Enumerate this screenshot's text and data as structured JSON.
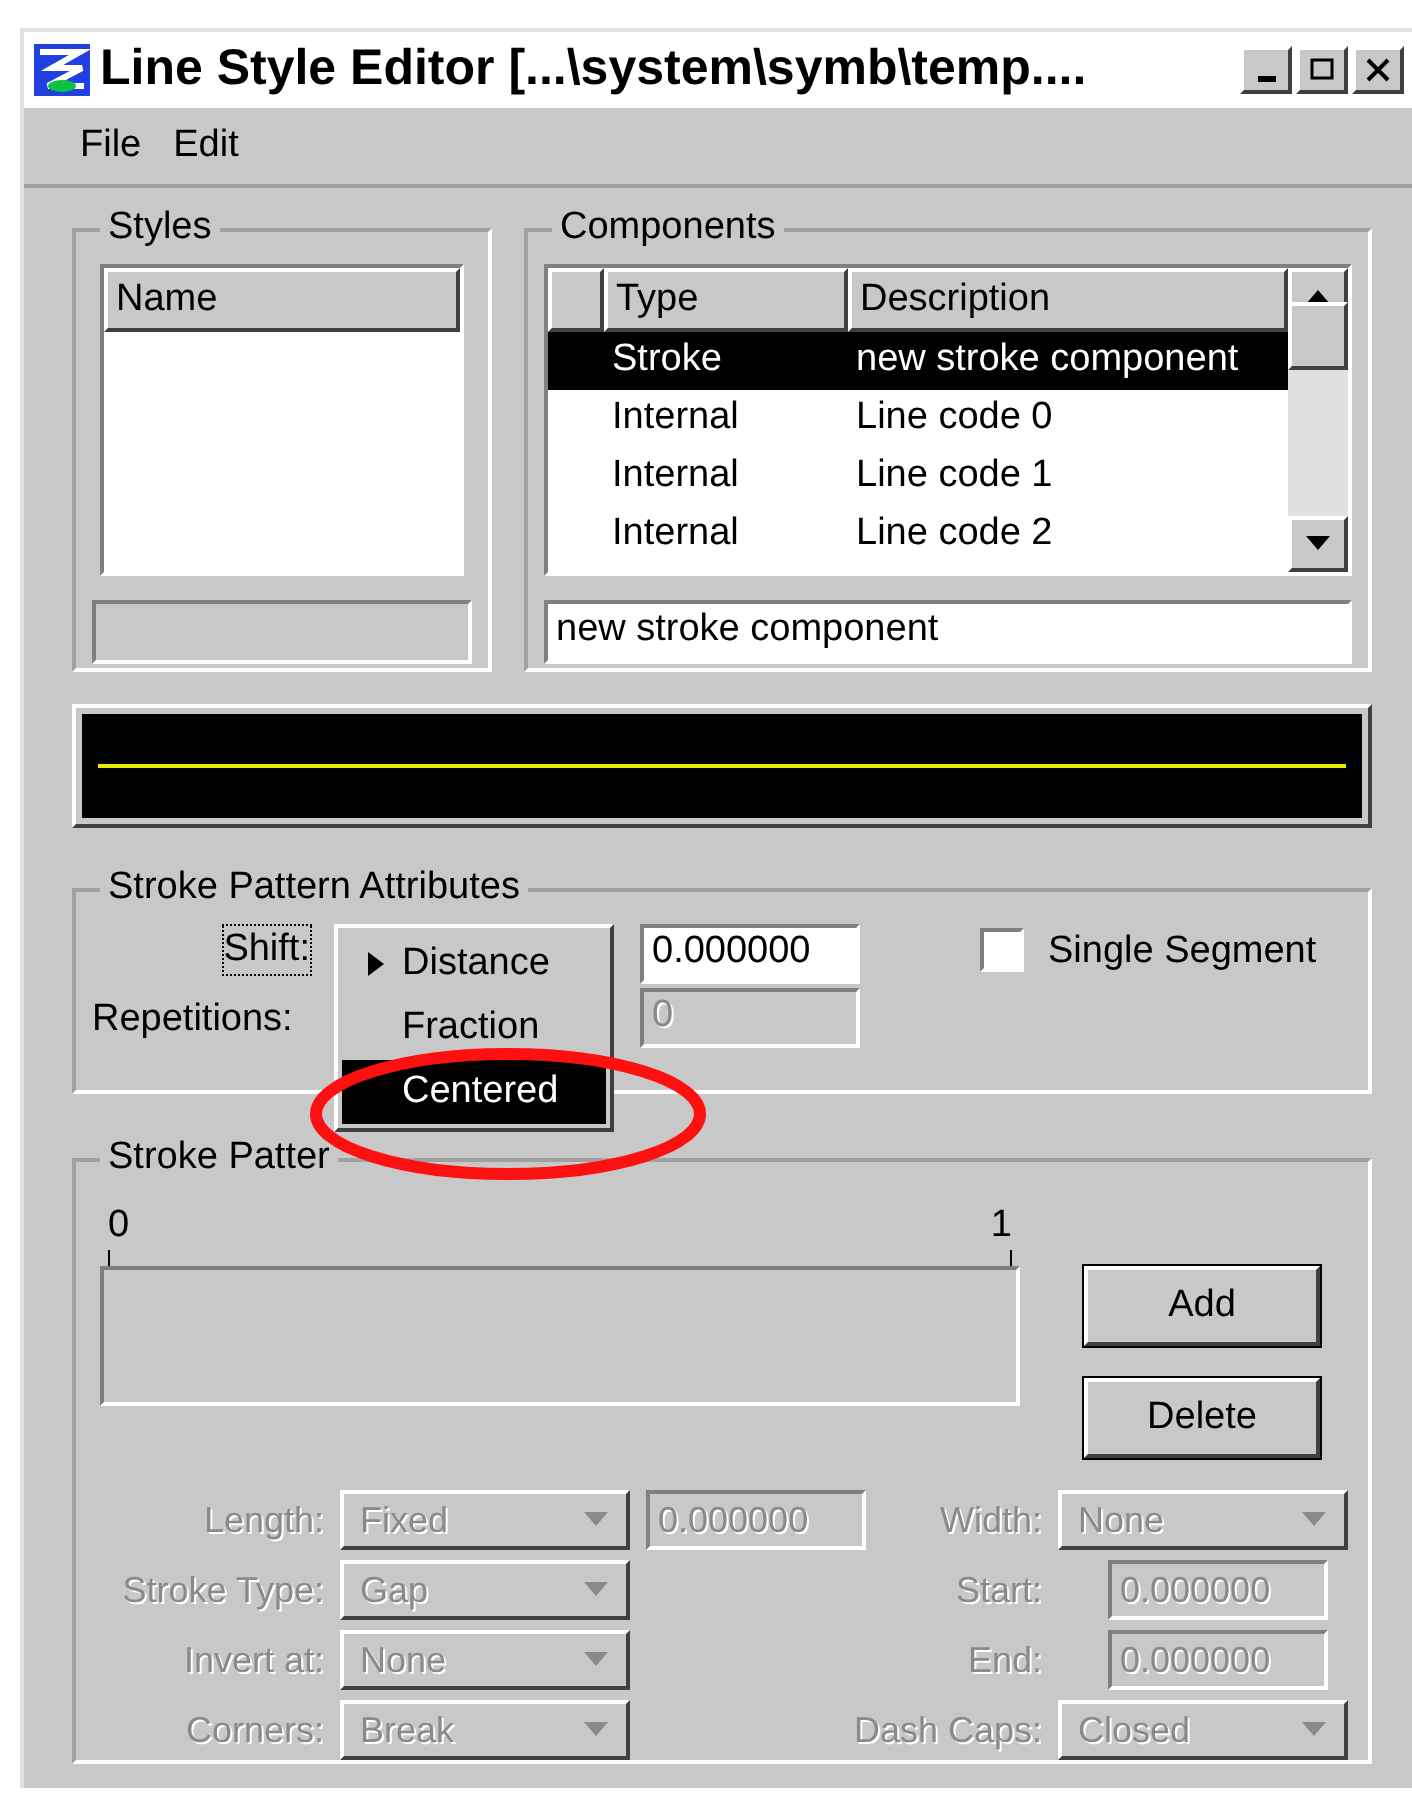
{
  "window": {
    "title": "Line Style Editor [...\\system\\symb\\temp...."
  },
  "menu": [
    {
      "label": "File"
    },
    {
      "label": "Edit"
    }
  ],
  "styles": {
    "title": "Styles",
    "columns": [
      "Name"
    ],
    "name_field": {
      "disabled": true
    }
  },
  "components": {
    "title": "Components",
    "columns": [
      "Type",
      "Description"
    ],
    "rows": [
      {
        "type": "Stroke",
        "description": "new stroke component",
        "selected": true
      },
      {
        "type": "Internal",
        "description": "Line code 0",
        "selected": false
      },
      {
        "type": "Internal",
        "description": "Line code 1",
        "selected": false
      },
      {
        "type": "Internal",
        "description": "Line code 2",
        "selected": false
      }
    ],
    "description_field": {
      "value": "new stroke component"
    }
  },
  "attributes": {
    "title": "Stroke Pattern Attributes",
    "shift": {
      "label": "Shift:",
      "value": "0.000000"
    },
    "repetitions": {
      "label": "Repetitions:",
      "value": "0",
      "disabled": true
    },
    "shift_menu": [
      {
        "label": "Distance",
        "checked": true,
        "selected": false
      },
      {
        "label": "Fraction",
        "checked": false,
        "selected": false
      },
      {
        "label": "Centered",
        "checked": false,
        "selected": true
      }
    ],
    "single_segment": {
      "label": "Single Segment",
      "checked": false
    }
  },
  "pattern": {
    "title": "Stroke Patter",
    "scale_start": "0",
    "scale_end": "1",
    "buttons": [
      {
        "label": "Add"
      },
      {
        "label": "Delete"
      }
    ],
    "fields": [
      {
        "kind": "select",
        "label": "Length:",
        "value": "Fixed",
        "disabled": true
      },
      {
        "kind": "input",
        "value": "0.000000",
        "disabled": true
      },
      {
        "kind": "select",
        "label": "Width:",
        "value": "None",
        "disabled": true
      },
      {
        "kind": "select",
        "label": "Stroke Type:",
        "value": "Gap",
        "disabled": true
      },
      {
        "kind": "input",
        "label": "Start:",
        "value": "0.000000",
        "disabled": true
      },
      {
        "kind": "select",
        "label": "Invert at:",
        "value": "None",
        "disabled": true
      },
      {
        "kind": "input",
        "label": "End:",
        "value": "0.000000",
        "disabled": true
      },
      {
        "kind": "select",
        "label": "Corners:",
        "value": "Break",
        "disabled": true
      },
      {
        "kind": "select",
        "label": "Dash Caps:",
        "value": "Closed",
        "disabled": true
      }
    ]
  }
}
